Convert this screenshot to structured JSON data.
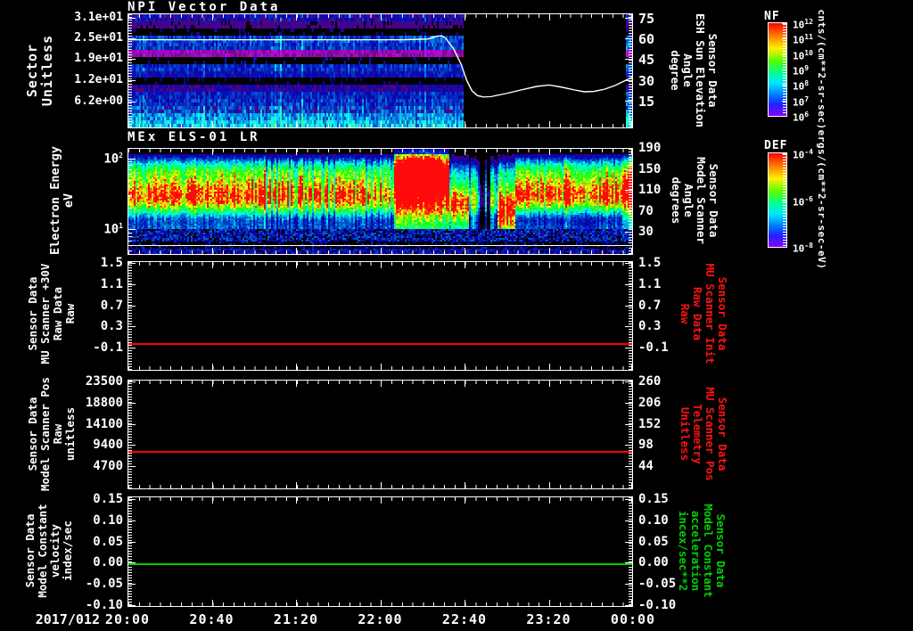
{
  "x_axis": {
    "date_label": "2017/012",
    "ticks": [
      "20:00",
      "20:40",
      "21:20",
      "22:00",
      "22:40",
      "23:20",
      "00:00"
    ]
  },
  "colors": {
    "background": "#000000",
    "text": "#ffffff",
    "red_series": "#ff0000",
    "green_series": "#00d000"
  },
  "chart_data": [
    {
      "type": "heatmap",
      "title": "NPI Vector Data",
      "left_axis": {
        "label": "Sector\nUnitless",
        "ticks": [
          {
            "label": "3.1e+01",
            "frac": 0.04
          },
          {
            "label": "2.5e+01",
            "frac": 0.22
          },
          {
            "label": "1.9e+01",
            "frac": 0.405
          },
          {
            "label": "1.2e+01",
            "frac": 0.59
          },
          {
            "label": "6.2e+00",
            "frac": 0.78
          }
        ]
      },
      "right_axis": {
        "label": "Sensor Data\nESH Sun Elevation\nAngle\ndegree",
        "color": "#ffffff",
        "ticks": [
          {
            "label": "75",
            "frac": 0.04
          },
          {
            "label": "60",
            "frac": 0.22
          },
          {
            "label": "45",
            "frac": 0.405
          },
          {
            "label": "30",
            "frac": 0.59
          },
          {
            "label": "15",
            "frac": 0.77
          }
        ]
      },
      "colorbar": {
        "name": "NF",
        "units": "cnts/(cm**2-sr-sec)",
        "tick_base": "10",
        "tick_exponents": [
          "12",
          "11",
          "10",
          "9",
          "8",
          "7",
          "6"
        ]
      },
      "value_range": [
        0,
        80
      ],
      "data_end_frac": 0.663,
      "right_edge_strip_frac": 0.985,
      "bands": [
        0.3,
        0.13,
        0.05,
        0.4,
        0.38,
        0.26,
        0.07,
        0.36,
        0.3,
        0.06,
        0.24,
        0.34,
        0.37,
        0.44,
        0.52,
        0.6
      ],
      "band_styles": [
        "speck",
        "speck",
        "dots",
        "solid",
        "solid",
        "speckp",
        "dots",
        "solid",
        "solid",
        "dots",
        "speck",
        "solid",
        "solid",
        "speck",
        "solid",
        "solid"
      ],
      "overlay_line": {
        "color": "#ffffff",
        "axis": "right",
        "points": [
          [
            0,
            62
          ],
          [
            0.4,
            62
          ],
          [
            0.55,
            62
          ],
          [
            0.595,
            62.5
          ],
          [
            0.612,
            64.5
          ],
          [
            0.622,
            64.8
          ],
          [
            0.63,
            63
          ],
          [
            0.645,
            56
          ],
          [
            0.66,
            45
          ],
          [
            0.672,
            33
          ],
          [
            0.682,
            26
          ],
          [
            0.693,
            22.5
          ],
          [
            0.705,
            21.5
          ],
          [
            0.72,
            21.8
          ],
          [
            0.75,
            24
          ],
          [
            0.78,
            26.5
          ],
          [
            0.81,
            29
          ],
          [
            0.835,
            30
          ],
          [
            0.86,
            28.5
          ],
          [
            0.885,
            26.5
          ],
          [
            0.905,
            25.2
          ],
          [
            0.925,
            25.5
          ],
          [
            0.945,
            27
          ],
          [
            0.965,
            29.5
          ],
          [
            0.98,
            32
          ],
          [
            1,
            35.5
          ]
        ]
      }
    },
    {
      "type": "heatmap",
      "title": "MEx ELS-01 LR",
      "left_axis": {
        "label": "Electron Energy\neV",
        "tick_base": "10",
        "log_ticks": [
          {
            "exp": "2",
            "frac": 0.1
          },
          {
            "exp": "1",
            "frac": 0.773
          }
        ],
        "decade_frac": 0.673
      },
      "right_axis": {
        "label": "Sensor Data\nModel Scanner\nAngle\ndegrees",
        "color": "#ffffff",
        "ticks": [
          {
            "label": "190",
            "frac": 0.0
          },
          {
            "label": "150",
            "frac": 0.2
          },
          {
            "label": "110",
            "frac": 0.4
          },
          {
            "label": "70",
            "frac": 0.6
          },
          {
            "label": "30",
            "frac": 0.8
          }
        ]
      },
      "colorbar": {
        "name": "DEF",
        "units": "ergs/(cm**2-sr-sec-eV)",
        "tick_base": "10",
        "tick_exponents": [
          "-4",
          "-6",
          "-8"
        ]
      },
      "overlay_line_frac": 0.916,
      "segments": [
        {
          "t0": 0.0,
          "t1": 0.24,
          "amp": 0.95,
          "fc": 0.44,
          "w": 0.125,
          "top": 1.0,
          "stri": 0.18
        },
        {
          "t0": 0.24,
          "t1": 0.5,
          "amp": 1.02,
          "fc": 0.44,
          "w": 0.125,
          "top": 1.0,
          "stri": 0.55
        },
        {
          "t0": 0.5,
          "t1": 0.525,
          "amp": 0.8,
          "fc": 0.45,
          "w": 0.12,
          "top": 1.0,
          "stri": 0.35
        },
        {
          "t0": 0.525,
          "t1": 0.635,
          "amp": 1.3,
          "fc": 0.38,
          "w": 0.21,
          "top": 1.3,
          "stri": 0.15
        },
        {
          "t0": 0.635,
          "t1": 0.675,
          "amp": 1.0,
          "fc": 0.52,
          "w": 0.13,
          "top": 0.35,
          "stri": 0.25
        },
        {
          "t0": 0.675,
          "t1": 0.73,
          "amp": 0.62,
          "fc": 0.48,
          "w": 0.12,
          "top": 0.2,
          "stri": 0.6
        },
        {
          "t0": 0.73,
          "t1": 0.765,
          "amp": 1.12,
          "fc": 0.56,
          "w": 0.16,
          "top": 0.45,
          "stri": 0.2
        },
        {
          "t0": 0.765,
          "t1": 0.98,
          "amp": 0.96,
          "fc": 0.43,
          "w": 0.12,
          "top": 0.95,
          "stri": 0.3
        },
        {
          "t0": 0.98,
          "t1": 1.001,
          "amp": 1.2,
          "fc": 0.42,
          "w": 0.15,
          "top": 1.0,
          "stri": 0.0
        }
      ],
      "dark_lanes": [
        [
          0.701,
          0.005
        ],
        [
          0.714,
          0.004
        ]
      ]
    },
    {
      "type": "line",
      "left_axis": {
        "label": "Sensor Data\nMU Scanner +30V\nRaw Data\nRaw",
        "ticks": [
          {
            "label": "1.5",
            "frac": 0.02
          },
          {
            "label": "1.1",
            "frac": 0.215
          },
          {
            "label": "0.7",
            "frac": 0.41
          },
          {
            "label": "0.3",
            "frac": 0.605
          },
          {
            "label": "-0.1",
            "frac": 0.8
          }
        ]
      },
      "right_axis": {
        "label": "Sensor Data\nMU Scanner Init\nRaw Data\nRaw",
        "color": "#ff1212",
        "ticks": [
          {
            "label": "1.5",
            "frac": 0.02
          },
          {
            "label": "1.1",
            "frac": 0.215
          },
          {
            "label": "0.7",
            "frac": 0.41
          },
          {
            "label": "0.3",
            "frac": 0.605
          },
          {
            "label": "-0.1",
            "frac": 0.8
          }
        ]
      },
      "series": {
        "color": "#ff0000",
        "y_frac": 0.755,
        "left_value": 0.0,
        "right_value": 0.0
      }
    },
    {
      "type": "line",
      "left_axis": {
        "label": "Sensor Data\nModel Scanner Pos\nRaw\nunitless",
        "ticks": [
          {
            "label": "23500",
            "frac": 0.02
          },
          {
            "label": "18800",
            "frac": 0.215
          },
          {
            "label": "14100",
            "frac": 0.41
          },
          {
            "label": "9400",
            "frac": 0.605
          },
          {
            "label": "4700",
            "frac": 0.8
          }
        ]
      },
      "right_axis": {
        "label": "Sensor Data\nMU Scanner Pos\nTelemetry\nUnitless",
        "color": "#ff1212",
        "ticks": [
          {
            "label": "260",
            "frac": 0.02
          },
          {
            "label": "206",
            "frac": 0.215
          },
          {
            "label": "152",
            "frac": 0.41
          },
          {
            "label": "98",
            "frac": 0.605
          },
          {
            "label": "44",
            "frac": 0.8
          }
        ]
      },
      "series": {
        "color": "#ff0000",
        "y_frac": 0.656,
        "left_value": 8200,
        "right_value": 86
      }
    },
    {
      "type": "line",
      "left_axis": {
        "label": "Sensor Data\nModel Constant\nvelocity\nindex/sec",
        "ticks": [
          {
            "label": "0.15",
            "frac": 0.024
          },
          {
            "label": "0.10",
            "frac": 0.22
          },
          {
            "label": "0.05",
            "frac": 0.415
          },
          {
            "label": "0.00",
            "frac": 0.61
          },
          {
            "label": "-0.05",
            "frac": 0.805
          },
          {
            "label": "-0.10",
            "frac": 1.0
          }
        ]
      },
      "right_axis": {
        "label": "Sensor Data\nModel Constant\nacceleration\nincex/sec**2",
        "color": "#00d000",
        "ticks": [
          {
            "label": "0.15",
            "frac": 0.024
          },
          {
            "label": "0.10",
            "frac": 0.22
          },
          {
            "label": "0.05",
            "frac": 0.415
          },
          {
            "label": "0.00",
            "frac": 0.61
          },
          {
            "label": "-0.05",
            "frac": 0.805
          },
          {
            "label": "-0.10",
            "frac": 1.0
          }
        ]
      },
      "series": {
        "color": "#00d000",
        "y_frac": 0.61,
        "left_value": 0.0,
        "right_value": 0.0
      }
    }
  ]
}
